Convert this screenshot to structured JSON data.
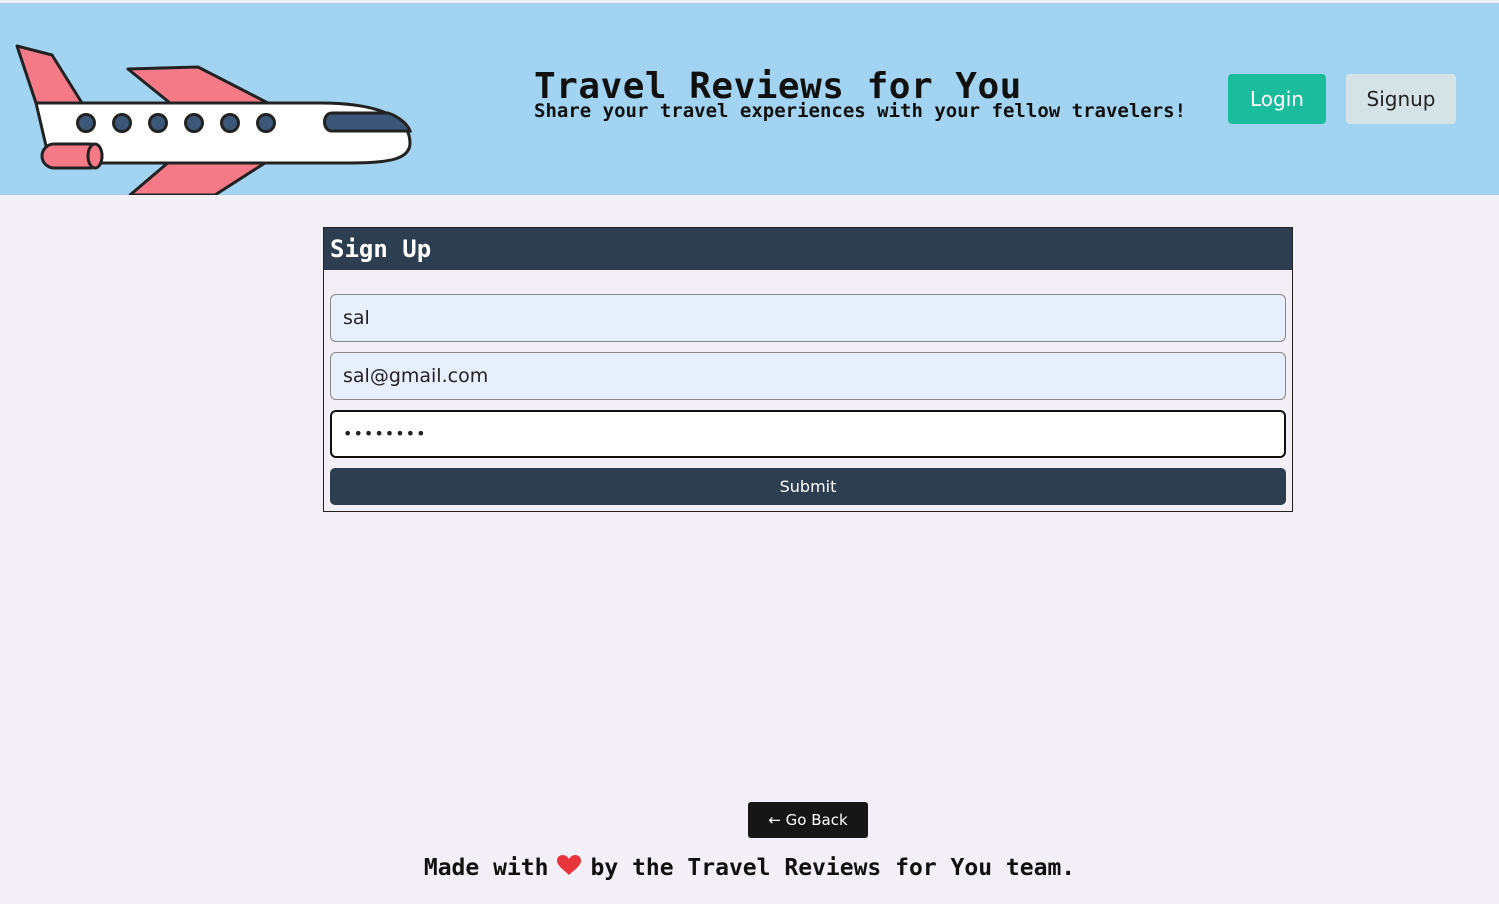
{
  "header": {
    "title": "Travel Reviews for You",
    "subtitle": "Share your travel experiences with your fellow travelers!",
    "login_label": "Login",
    "signup_label": "Signup",
    "background_color": "#a2d4f2"
  },
  "signup_form": {
    "heading": "Sign Up",
    "username_value": "sal",
    "email_value": "sal@gmail.com",
    "password_value": "••••••••",
    "submit_label": "Submit"
  },
  "navigation": {
    "back_label": "← Go Back"
  },
  "footer": {
    "prefix": "Made with",
    "suffix": "by the Travel Reviews for You team.",
    "heart_icon": "heart-icon"
  },
  "colors": {
    "accent_teal": "#1abc9c",
    "dark_navy": "#2c3e50",
    "heart_red": "#e8353b"
  }
}
